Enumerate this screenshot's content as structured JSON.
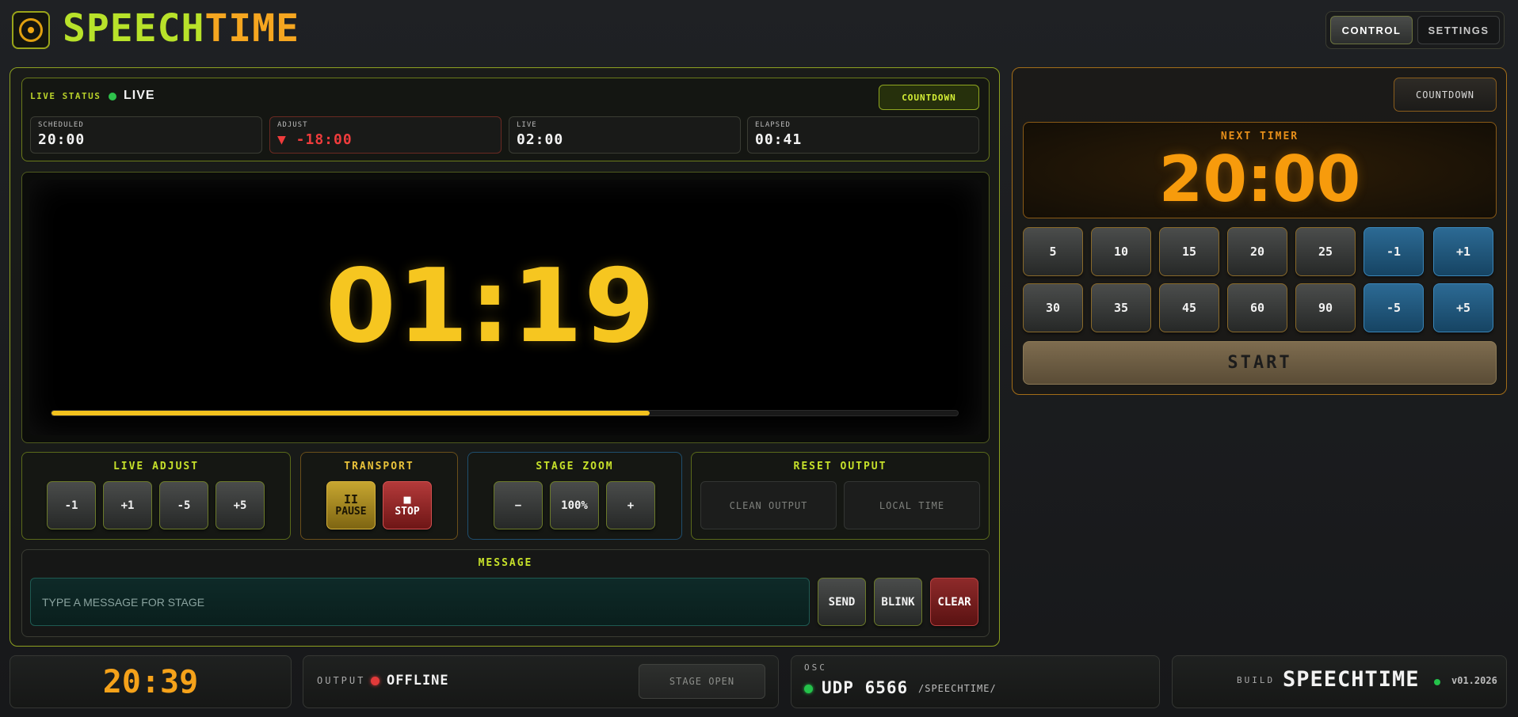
{
  "app": {
    "brand_part1": "SPEECH",
    "brand_part2": "TIME"
  },
  "top_tabs": [
    {
      "label": "CONTROL",
      "active": true
    },
    {
      "label": "SETTINGS",
      "active": false
    }
  ],
  "status": {
    "label": "LIVE STATUS",
    "state": "LIVE",
    "mode_badge": "COUNTDOWN",
    "stats": [
      {
        "key": "SCHEDULED",
        "value": "20:00"
      },
      {
        "key": "ADJUST",
        "value": "▼ -18:00"
      },
      {
        "key": "LIVE",
        "value": "02:00"
      },
      {
        "key": "ELAPSED",
        "value": "00:41"
      }
    ]
  },
  "stage": {
    "time": "01:19",
    "progress": 0.66
  },
  "live_adjust": {
    "title": "LIVE ADJUST",
    "buttons": [
      "-1",
      "+1",
      "-5",
      "+5"
    ]
  },
  "transport": {
    "title": "TRANSPORT",
    "pause_icon": "II",
    "pause_label": "PAUSE",
    "stop_icon": "■",
    "stop_label": "STOP"
  },
  "stage_zoom": {
    "title": "STAGE ZOOM",
    "minus": "−",
    "value": "100%",
    "plus": "+"
  },
  "reset_output": {
    "title": "RESET OUTPUT",
    "clean": "CLEAN OUTPUT",
    "local": "LOCAL TIME"
  },
  "message": {
    "title": "MESSAGE",
    "placeholder": "TYPE A MESSAGE FOR STAGE",
    "send": "SEND",
    "blink": "BLINK",
    "clear": "CLEAR"
  },
  "right": {
    "mode_button": "COUNTDOWN",
    "next_label": "NEXT TIMER",
    "next_time": "20:00",
    "row1": [
      "5",
      "10",
      "15",
      "20",
      "25",
      "-1",
      "+1"
    ],
    "row2": [
      "30",
      "35",
      "45",
      "60",
      "90",
      "-5",
      "+5"
    ],
    "start": "START"
  },
  "footer": {
    "clock": "20:39",
    "output_label": "OUTPUT",
    "output_state": "OFFLINE",
    "stage_open": "STAGE OPEN",
    "osc_label": "OSC",
    "osc_value": "UDP 6566",
    "osc_path": "/SPEECHTIME/",
    "build_label": "BUILD",
    "build_name": "SPEECHTIME",
    "build_version": "v01.2026"
  },
  "colors": {
    "accent_green": "#b8e22a",
    "accent_orange": "#f5a620",
    "stage_yellow": "#f6c620",
    "live_green": "#2ec24b",
    "offline_red": "#e23a3a"
  }
}
